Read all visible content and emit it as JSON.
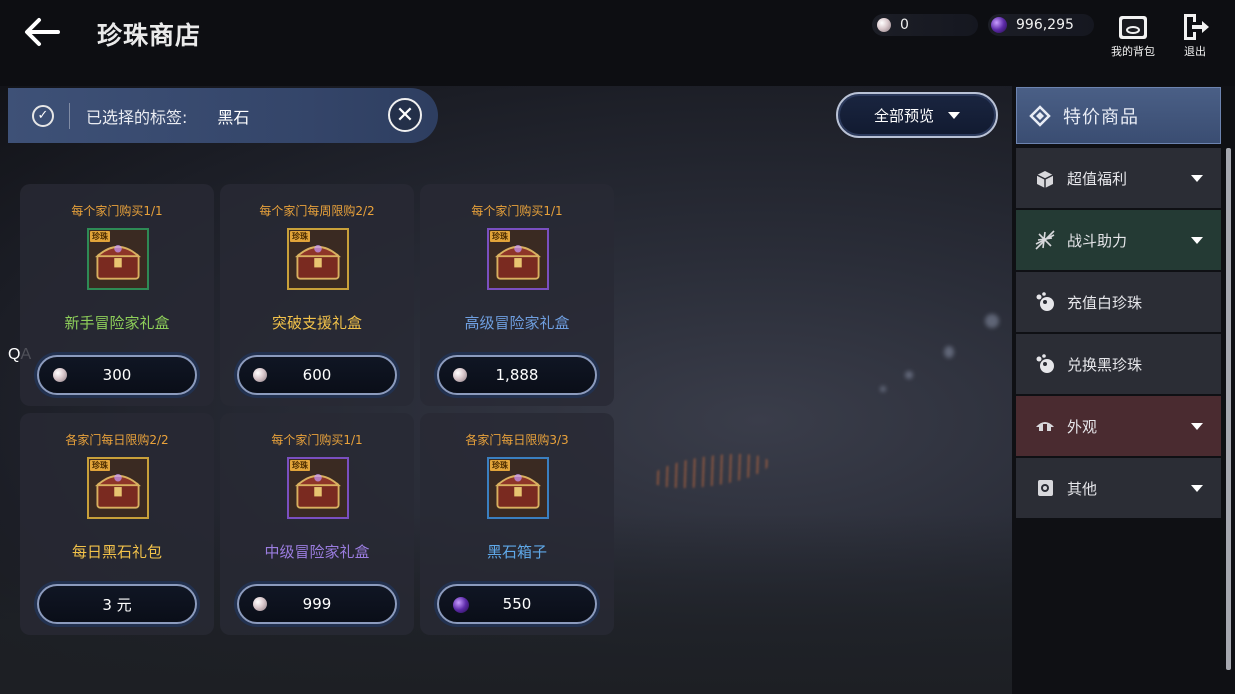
{
  "header": {
    "title": "珍珠商店",
    "white_pearls": "0",
    "black_pearls": "996,295",
    "bag_label": "我的背包",
    "exit_label": "退出"
  },
  "filter": {
    "label": "已选择的标签:",
    "value": "黑石",
    "preview_label": "全部预览"
  },
  "qa_label": "QA",
  "products": [
    {
      "limit": "每个家门购买1/1",
      "name": "新手冒险家礼盒",
      "price": "300",
      "currency": "white-pearl",
      "name_color": "#8ecf5a",
      "frame_color": "#2e8a55"
    },
    {
      "limit": "每个家门每周限购2/2",
      "name": "突破支援礼盒",
      "price": "600",
      "currency": "white-pearl",
      "name_color": "#f2c24a",
      "frame_color": "#c8a03a"
    },
    {
      "limit": "每个家门购买1/1",
      "name": "高级冒险家礼盒",
      "price": "1,888",
      "currency": "white-pearl",
      "name_color": "#6f9fe0",
      "frame_color": "#7a4fc0"
    },
    {
      "limit": "各家门每日限购2/2",
      "name": "每日黑石礼包",
      "price": "3 元",
      "currency": "none",
      "name_color": "#f2c24a",
      "frame_color": "#c8a03a"
    },
    {
      "limit": "每个家门购买1/1",
      "name": "中级冒险家礼盒",
      "price": "999",
      "currency": "white-pearl",
      "name_color": "#9b7de0",
      "frame_color": "#7a4fc0"
    },
    {
      "limit": "各家门每日限购3/3",
      "name": "黑石箱子",
      "price": "550",
      "currency": "black-pearl",
      "name_color": "#5fa8e8",
      "frame_color": "#3a7fc0"
    }
  ],
  "sidebar": {
    "top": "特价商品",
    "items": [
      {
        "label": "超值福利",
        "icon": "gift-box-icon",
        "has_caret": true,
        "bg": "#2b2d35"
      },
      {
        "label": "战斗助力",
        "icon": "burst-icon",
        "has_caret": true,
        "bg": "#243a34"
      },
      {
        "label": "充值白珍珠",
        "icon": "pearl-cluster-icon",
        "has_caret": false,
        "bg": "#2b2d35"
      },
      {
        "label": "兑换黑珍珠",
        "icon": "pearl-cluster-icon",
        "has_caret": false,
        "bg": "#2b2d35"
      },
      {
        "label": "外观",
        "icon": "helmet-icon",
        "has_caret": true,
        "bg": "#4a2b30"
      },
      {
        "label": "其他",
        "icon": "scroll-icon",
        "has_caret": true,
        "bg": "#2b2d35"
      }
    ]
  }
}
